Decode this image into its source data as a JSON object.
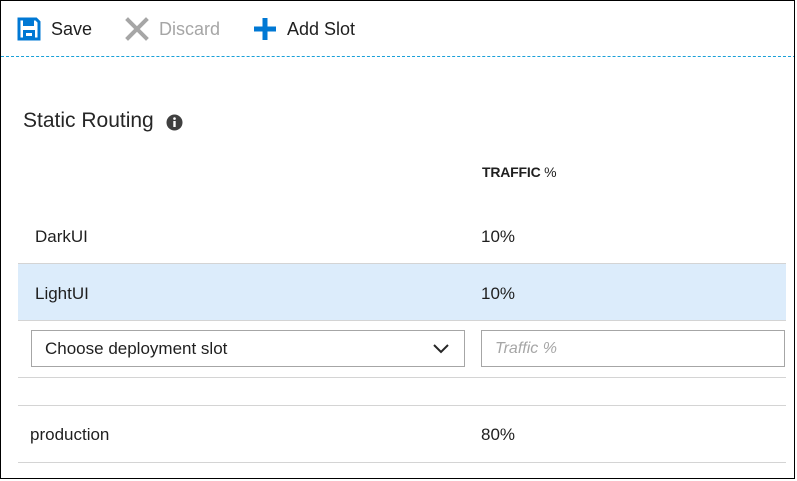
{
  "toolbar": {
    "save_label": "Save",
    "discard_label": "Discard",
    "add_slot_label": "Add Slot"
  },
  "section": {
    "title": "Static Routing"
  },
  "table": {
    "header_traffic_bold": "TRAFFIC",
    "header_traffic_suffix": " %",
    "rows": [
      {
        "name": "DarkUI",
        "traffic": "10%"
      },
      {
        "name": "LightUI",
        "traffic": "10%",
        "selected": true
      }
    ],
    "new_row": {
      "slot_select_value": "Choose deployment slot",
      "traffic_placeholder": "Traffic %"
    },
    "production": {
      "name": "production",
      "traffic": "80%"
    }
  },
  "colors": {
    "accent": "#0078d4",
    "selected_row": "#dcecfb",
    "disabled": "#a6a6a6",
    "divider": "#1aa0d8"
  },
  "icons": {
    "save": "save-icon",
    "discard": "close-icon",
    "add": "plus-icon",
    "info": "info-icon",
    "dropdown": "chevron-down-icon"
  }
}
